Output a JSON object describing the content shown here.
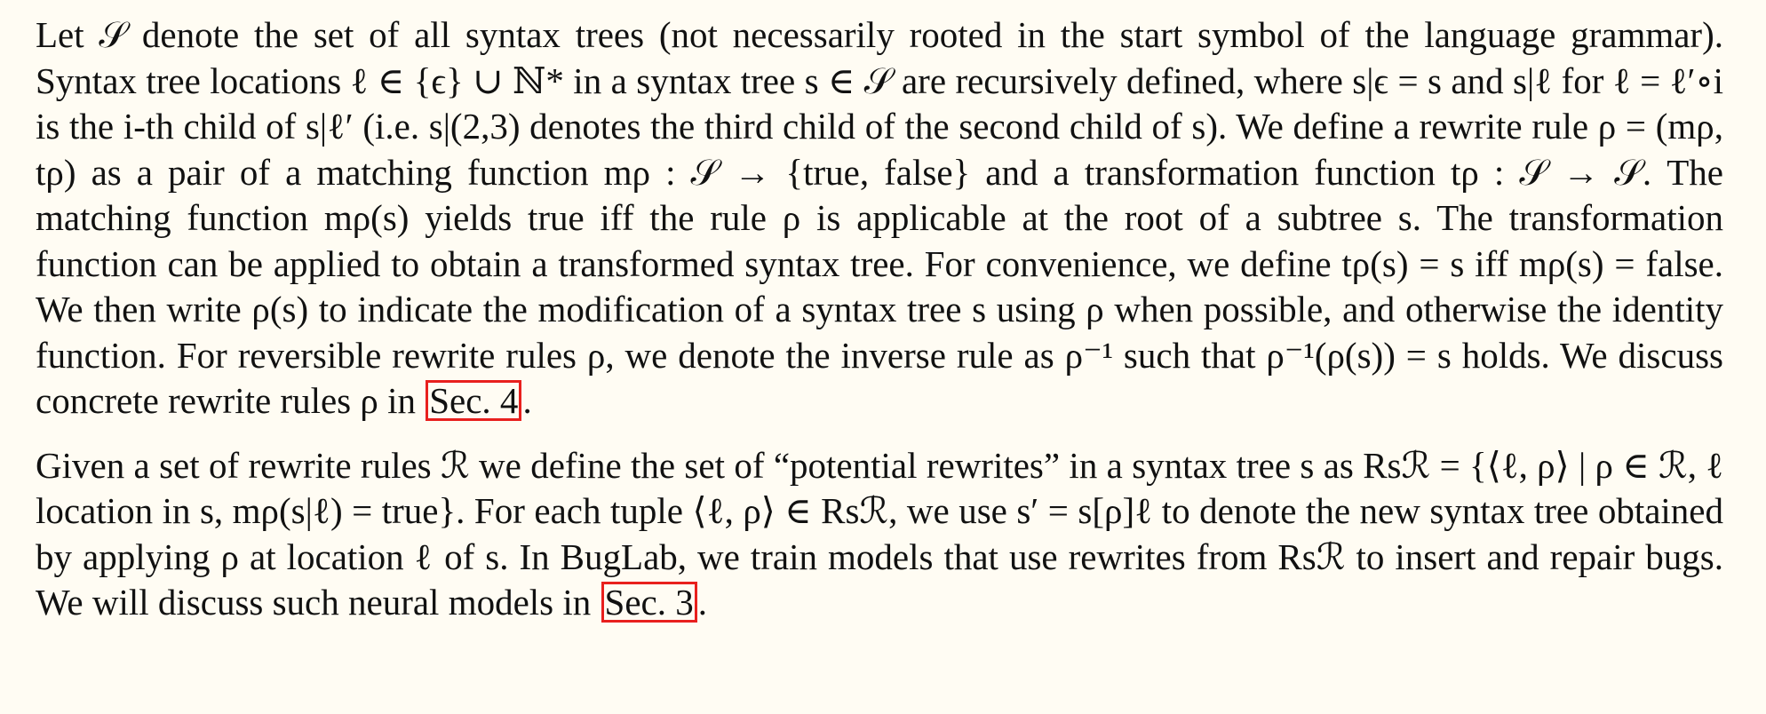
{
  "paragraphs": [
    {
      "before": "Let 𝒮 denote the set of all syntax trees (not necessarily rooted in the start symbol of the language grammar). Syntax tree locations ℓ ∈ {ϵ} ∪ ℕ* in a syntax tree s ∈ 𝒮 are recursively defined, where s|ϵ = s and s|ℓ for ℓ = ℓ′∘i is the i-th child of s|ℓ′ (i.e. s|(2,3) denotes the third child of the second child of s). We define a rewrite rule ρ = (mρ, tρ) as a pair of a matching function mρ : 𝒮 → {true, false} and a transformation function tρ : 𝒮 → 𝒮. The matching function mρ(s) yields true iff the rule ρ is applicable at the root of a subtree s. The transformation function can be applied to obtain a transformed syntax tree. For convenience, we define tρ(s) = s iff mρ(s) = false. We then write ρ(s) to indicate the modification of a syntax tree s using ρ when possible, and otherwise the identity function. For reversible rewrite rules ρ, we denote the inverse rule as ρ⁻¹ such that ρ⁻¹(ρ(s)) = s holds. We discuss concrete rewrite rules ρ in",
      "link": "Sec. 4",
      "after": "."
    },
    {
      "before": "Given a set of rewrite rules ℛ we define the set of “potential rewrites” in a syntax tree s as Rsℛ = {⟨ℓ, ρ⟩ | ρ ∈ ℛ, ℓ location in s, mρ(s|ℓ) = true}. For each tuple ⟨ℓ, ρ⟩ ∈ Rsℛ, we use s′ = s[ρ]ℓ to denote the new syntax tree obtained by applying ρ at location ℓ of s. In BugLab, we train models that use rewrites from Rsℛ to insert and repair bugs. We will discuss such neural models in",
      "link": "Sec. 3",
      "after": "."
    }
  ],
  "colors": {
    "link_border": "#e8201e",
    "background": "#fffcf3",
    "text": "#111111"
  }
}
